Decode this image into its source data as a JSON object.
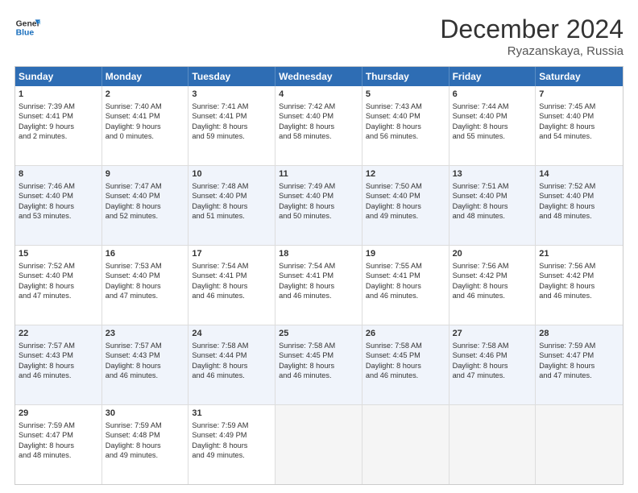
{
  "header": {
    "logo_general": "General",
    "logo_blue": "Blue",
    "month_title": "December 2024",
    "location": "Ryazanskaya, Russia"
  },
  "days_of_week": [
    "Sunday",
    "Monday",
    "Tuesday",
    "Wednesday",
    "Thursday",
    "Friday",
    "Saturday"
  ],
  "weeks": [
    [
      {
        "day": "1",
        "lines": [
          "Sunrise: 7:39 AM",
          "Sunset: 4:41 PM",
          "Daylight: 9 hours",
          "and 2 minutes."
        ]
      },
      {
        "day": "2",
        "lines": [
          "Sunrise: 7:40 AM",
          "Sunset: 4:41 PM",
          "Daylight: 9 hours",
          "and 0 minutes."
        ]
      },
      {
        "day": "3",
        "lines": [
          "Sunrise: 7:41 AM",
          "Sunset: 4:41 PM",
          "Daylight: 8 hours",
          "and 59 minutes."
        ]
      },
      {
        "day": "4",
        "lines": [
          "Sunrise: 7:42 AM",
          "Sunset: 4:40 PM",
          "Daylight: 8 hours",
          "and 58 minutes."
        ]
      },
      {
        "day": "5",
        "lines": [
          "Sunrise: 7:43 AM",
          "Sunset: 4:40 PM",
          "Daylight: 8 hours",
          "and 56 minutes."
        ]
      },
      {
        "day": "6",
        "lines": [
          "Sunrise: 7:44 AM",
          "Sunset: 4:40 PM",
          "Daylight: 8 hours",
          "and 55 minutes."
        ]
      },
      {
        "day": "7",
        "lines": [
          "Sunrise: 7:45 AM",
          "Sunset: 4:40 PM",
          "Daylight: 8 hours",
          "and 54 minutes."
        ]
      }
    ],
    [
      {
        "day": "8",
        "lines": [
          "Sunrise: 7:46 AM",
          "Sunset: 4:40 PM",
          "Daylight: 8 hours",
          "and 53 minutes."
        ]
      },
      {
        "day": "9",
        "lines": [
          "Sunrise: 7:47 AM",
          "Sunset: 4:40 PM",
          "Daylight: 8 hours",
          "and 52 minutes."
        ]
      },
      {
        "day": "10",
        "lines": [
          "Sunrise: 7:48 AM",
          "Sunset: 4:40 PM",
          "Daylight: 8 hours",
          "and 51 minutes."
        ]
      },
      {
        "day": "11",
        "lines": [
          "Sunrise: 7:49 AM",
          "Sunset: 4:40 PM",
          "Daylight: 8 hours",
          "and 50 minutes."
        ]
      },
      {
        "day": "12",
        "lines": [
          "Sunrise: 7:50 AM",
          "Sunset: 4:40 PM",
          "Daylight: 8 hours",
          "and 49 minutes."
        ]
      },
      {
        "day": "13",
        "lines": [
          "Sunrise: 7:51 AM",
          "Sunset: 4:40 PM",
          "Daylight: 8 hours",
          "and 48 minutes."
        ]
      },
      {
        "day": "14",
        "lines": [
          "Sunrise: 7:52 AM",
          "Sunset: 4:40 PM",
          "Daylight: 8 hours",
          "and 48 minutes."
        ]
      }
    ],
    [
      {
        "day": "15",
        "lines": [
          "Sunrise: 7:52 AM",
          "Sunset: 4:40 PM",
          "Daylight: 8 hours",
          "and 47 minutes."
        ]
      },
      {
        "day": "16",
        "lines": [
          "Sunrise: 7:53 AM",
          "Sunset: 4:40 PM",
          "Daylight: 8 hours",
          "and 47 minutes."
        ]
      },
      {
        "day": "17",
        "lines": [
          "Sunrise: 7:54 AM",
          "Sunset: 4:41 PM",
          "Daylight: 8 hours",
          "and 46 minutes."
        ]
      },
      {
        "day": "18",
        "lines": [
          "Sunrise: 7:54 AM",
          "Sunset: 4:41 PM",
          "Daylight: 8 hours",
          "and 46 minutes."
        ]
      },
      {
        "day": "19",
        "lines": [
          "Sunrise: 7:55 AM",
          "Sunset: 4:41 PM",
          "Daylight: 8 hours",
          "and 46 minutes."
        ]
      },
      {
        "day": "20",
        "lines": [
          "Sunrise: 7:56 AM",
          "Sunset: 4:42 PM",
          "Daylight: 8 hours",
          "and 46 minutes."
        ]
      },
      {
        "day": "21",
        "lines": [
          "Sunrise: 7:56 AM",
          "Sunset: 4:42 PM",
          "Daylight: 8 hours",
          "and 46 minutes."
        ]
      }
    ],
    [
      {
        "day": "22",
        "lines": [
          "Sunrise: 7:57 AM",
          "Sunset: 4:43 PM",
          "Daylight: 8 hours",
          "and 46 minutes."
        ]
      },
      {
        "day": "23",
        "lines": [
          "Sunrise: 7:57 AM",
          "Sunset: 4:43 PM",
          "Daylight: 8 hours",
          "and 46 minutes."
        ]
      },
      {
        "day": "24",
        "lines": [
          "Sunrise: 7:58 AM",
          "Sunset: 4:44 PM",
          "Daylight: 8 hours",
          "and 46 minutes."
        ]
      },
      {
        "day": "25",
        "lines": [
          "Sunrise: 7:58 AM",
          "Sunset: 4:45 PM",
          "Daylight: 8 hours",
          "and 46 minutes."
        ]
      },
      {
        "day": "26",
        "lines": [
          "Sunrise: 7:58 AM",
          "Sunset: 4:45 PM",
          "Daylight: 8 hours",
          "and 46 minutes."
        ]
      },
      {
        "day": "27",
        "lines": [
          "Sunrise: 7:58 AM",
          "Sunset: 4:46 PM",
          "Daylight: 8 hours",
          "and 47 minutes."
        ]
      },
      {
        "day": "28",
        "lines": [
          "Sunrise: 7:59 AM",
          "Sunset: 4:47 PM",
          "Daylight: 8 hours",
          "and 47 minutes."
        ]
      }
    ],
    [
      {
        "day": "29",
        "lines": [
          "Sunrise: 7:59 AM",
          "Sunset: 4:47 PM",
          "Daylight: 8 hours",
          "and 48 minutes."
        ]
      },
      {
        "day": "30",
        "lines": [
          "Sunrise: 7:59 AM",
          "Sunset: 4:48 PM",
          "Daylight: 8 hours",
          "and 49 minutes."
        ]
      },
      {
        "day": "31",
        "lines": [
          "Sunrise: 7:59 AM",
          "Sunset: 4:49 PM",
          "Daylight: 8 hours",
          "and 49 minutes."
        ]
      },
      {
        "day": "",
        "lines": []
      },
      {
        "day": "",
        "lines": []
      },
      {
        "day": "",
        "lines": []
      },
      {
        "day": "",
        "lines": []
      }
    ]
  ]
}
